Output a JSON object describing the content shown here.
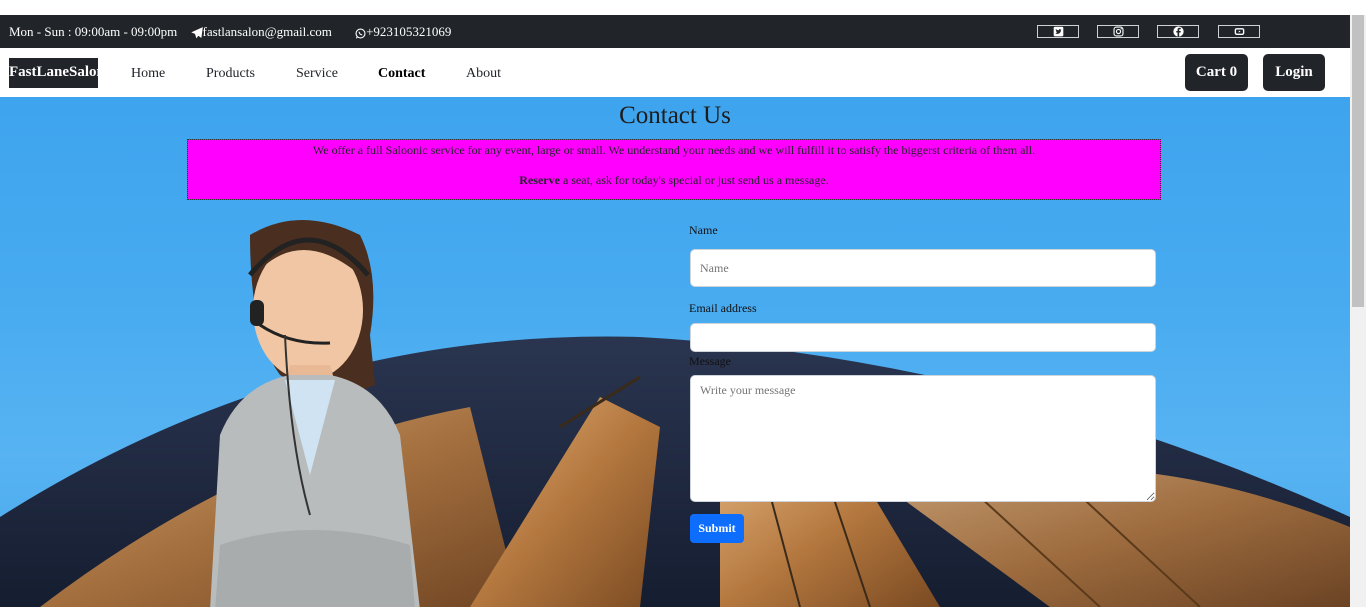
{
  "topbar": {
    "hours": "Mon - Sun : 09:00am - 09:00pm",
    "email": "fastlansalon@gmail.com",
    "phone": "+923105321069",
    "social_icons": [
      "twitter-icon",
      "instagram-icon",
      "facebook-icon",
      "youtube-icon"
    ]
  },
  "navbar": {
    "brand": "FastLaneSalon",
    "links": [
      "Home",
      "Products",
      "Service",
      "Contact",
      "About"
    ],
    "active": "Contact",
    "cart_label": "Cart 0",
    "login_label": "Login"
  },
  "contact": {
    "title": "Contact Us",
    "notice_line1": "We offer a full Saloonic service for any event, large or small. We understand your needs and we will fulfill it to satisfy the biggerst criteria of them all.",
    "notice_bold": "Reserve",
    "notice_line2_rest": " a seat, ask for today's special or just send us a message.",
    "name_label": "Name",
    "name_placeholder": "Name",
    "email_label": "Email address",
    "email_value": "",
    "message_label": "Message",
    "message_placeholder": "Write your message",
    "submit_label": "Submit"
  },
  "colors": {
    "dark": "#212529",
    "notice_bg": "#ff00ff",
    "primary": "#0d6efd",
    "sky": "#48abf0"
  }
}
